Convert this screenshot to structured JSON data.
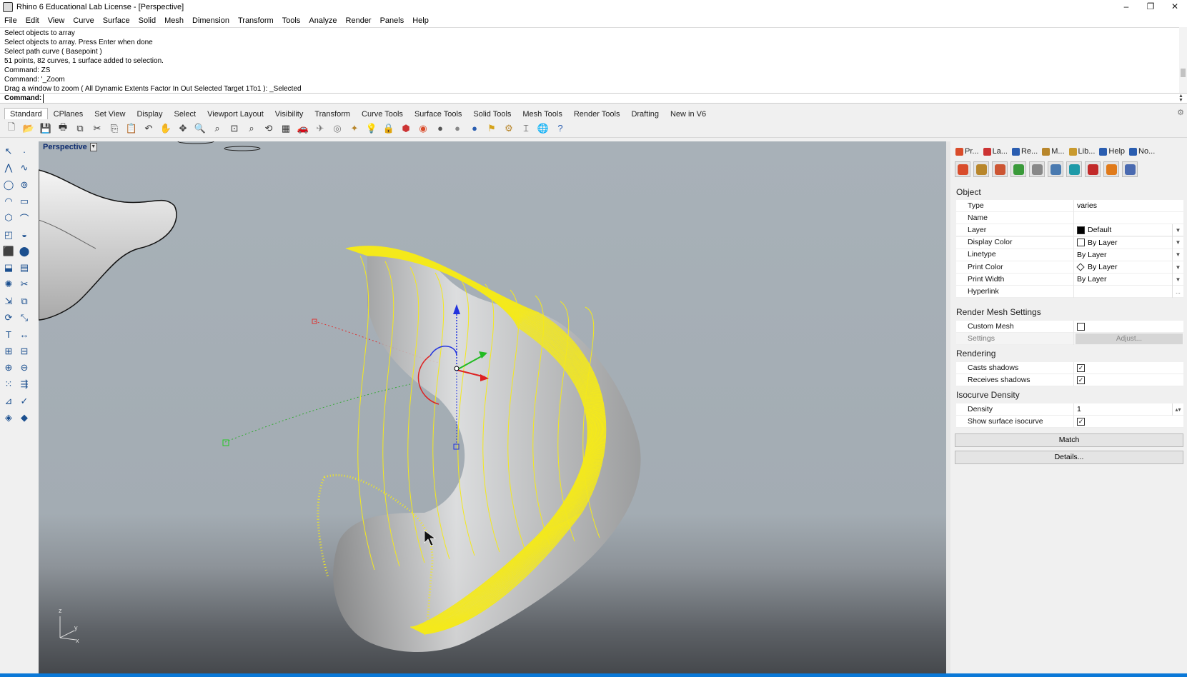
{
  "window": {
    "title": "Rhino 6 Educational Lab License - [Perspective]",
    "controls": [
      "–",
      "❐",
      "✕"
    ]
  },
  "menu": [
    "File",
    "Edit",
    "View",
    "Curve",
    "Surface",
    "Solid",
    "Mesh",
    "Dimension",
    "Transform",
    "Tools",
    "Analyze",
    "Render",
    "Panels",
    "Help"
  ],
  "history": [
    "Select objects to array",
    "Select objects to array. Press Enter when done",
    "Select path curve ( Basepoint )",
    "51 points, 82 curves, 1 surface added to selection.",
    "Command: ZS",
    "Command: '_Zoom",
    "Drag a window to zoom ( All  Dynamic  Extents  Factor  In  Out  Selected  Target  1To1 ): _Selected"
  ],
  "command": {
    "label": "Command:",
    "value": ""
  },
  "toolbar_tabs": [
    "Standard",
    "CPlanes",
    "Set View",
    "Display",
    "Select",
    "Viewport Layout",
    "Visibility",
    "Transform",
    "Curve Tools",
    "Surface Tools",
    "Solid Tools",
    "Mesh Tools",
    "Render Tools",
    "Drafting",
    "New in V6"
  ],
  "toolbar_icons": [
    {
      "name": "new-file-icon",
      "glyph": "🗋",
      "color": "#555555"
    },
    {
      "name": "open-icon",
      "glyph": "📂",
      "color": "#c99a2e"
    },
    {
      "name": "save-icon",
      "glyph": "💾",
      "color": "#333333"
    },
    {
      "name": "print-icon",
      "glyph": "🖶",
      "color": "#333333"
    },
    {
      "name": "import-icon",
      "glyph": "⧉",
      "color": "#333333"
    },
    {
      "name": "cut-icon",
      "glyph": "✂",
      "color": "#333333"
    },
    {
      "name": "copy-icon",
      "glyph": "⎘",
      "color": "#333333"
    },
    {
      "name": "paste-icon",
      "glyph": "📋",
      "color": "#c99a2e"
    },
    {
      "name": "undo-icon",
      "glyph": "↶",
      "color": "#333333"
    },
    {
      "name": "pan-icon",
      "glyph": "✋",
      "color": "#333333"
    },
    {
      "name": "rotate-view-icon",
      "glyph": "✥",
      "color": "#333333"
    },
    {
      "name": "zoom-icon",
      "glyph": "🔍",
      "color": "#333333"
    },
    {
      "name": "zoom-window-icon",
      "glyph": "⌕",
      "color": "#333333"
    },
    {
      "name": "zoom-extents-icon",
      "glyph": "⊡",
      "color": "#333333"
    },
    {
      "name": "zoom-selected-icon",
      "glyph": "⌕",
      "color": "#333333"
    },
    {
      "name": "undo-view-icon",
      "glyph": "⟲",
      "color": "#333333"
    },
    {
      "name": "four-viewports-icon",
      "glyph": "▦",
      "color": "#333333"
    },
    {
      "name": "car-icon",
      "glyph": "🚗",
      "color": "#cc2222"
    },
    {
      "name": "plane-icon",
      "glyph": "✈",
      "color": "#777777"
    },
    {
      "name": "osnap-icon",
      "glyph": "◎",
      "color": "#777777"
    },
    {
      "name": "object-properties-icon",
      "glyph": "✦",
      "color": "#b8862b"
    },
    {
      "name": "light-icon",
      "glyph": "💡",
      "color": "#888888"
    },
    {
      "name": "lock-icon",
      "glyph": "🔒",
      "color": "#333333"
    },
    {
      "name": "layers-icon",
      "glyph": "⬢",
      "color": "#cc3333"
    },
    {
      "name": "color-wheel-icon",
      "glyph": "◉",
      "color": "#d94c2b"
    },
    {
      "name": "shaded-sphere-icon",
      "glyph": "●",
      "color": "#555555"
    },
    {
      "name": "rendered-sphere-icon",
      "glyph": "●",
      "color": "#888888"
    },
    {
      "name": "render-sphere-icon",
      "glyph": "●",
      "color": "#2a5db0"
    },
    {
      "name": "flag-icon",
      "glyph": "⚑",
      "color": "#d4a21a"
    },
    {
      "name": "gear-icon",
      "glyph": "⚙",
      "color": "#b8862b"
    },
    {
      "name": "dimension-icon",
      "glyph": "⌶",
      "color": "#333333"
    },
    {
      "name": "globe-icon",
      "glyph": "🌐",
      "color": "#3a8a3a"
    },
    {
      "name": "help-icon",
      "glyph": "?",
      "color": "#2a5db0"
    }
  ],
  "left_tools": [
    {
      "name": "select-arrow-icon",
      "glyph": "↖"
    },
    {
      "name": "point-icon",
      "glyph": "·"
    },
    {
      "name": "polyline-icon",
      "glyph": "⋀"
    },
    {
      "name": "curve-icon",
      "glyph": "∿"
    },
    {
      "name": "circle-icon",
      "glyph": "◯"
    },
    {
      "name": "ellipse-icon",
      "glyph": "⊚"
    },
    {
      "name": "arc-icon",
      "glyph": "◠"
    },
    {
      "name": "rectangle-icon",
      "glyph": "▭"
    },
    {
      "name": "polygon-icon",
      "glyph": "⬡"
    },
    {
      "name": "fillet-icon",
      "glyph": "⌒"
    },
    {
      "name": "surface-corner-icon",
      "glyph": "◰"
    },
    {
      "name": "surface-loft-icon",
      "glyph": "◒"
    },
    {
      "name": "box-icon",
      "glyph": "⬛"
    },
    {
      "name": "boolean-icon",
      "glyph": "⬤"
    },
    {
      "name": "extrude-icon",
      "glyph": "⬓"
    },
    {
      "name": "mesh-icon",
      "glyph": "▤"
    },
    {
      "name": "explode-icon",
      "glyph": "✺"
    },
    {
      "name": "trim-icon",
      "glyph": "✂"
    },
    {
      "name": "move-icon",
      "glyph": "⇲"
    },
    {
      "name": "copy-tool-icon",
      "glyph": "⧉"
    },
    {
      "name": "rotate-icon",
      "glyph": "⟳"
    },
    {
      "name": "scale-icon",
      "glyph": "⤡"
    },
    {
      "name": "text-icon",
      "glyph": "T"
    },
    {
      "name": "dimension-tool-icon",
      "glyph": "↔"
    },
    {
      "name": "group-icon",
      "glyph": "⊞"
    },
    {
      "name": "array-icon",
      "glyph": "⊟"
    },
    {
      "name": "join-icon",
      "glyph": "⊕"
    },
    {
      "name": "split-icon",
      "glyph": "⊖"
    },
    {
      "name": "grid-array-icon",
      "glyph": "⁙"
    },
    {
      "name": "flow-icon",
      "glyph": "⇶"
    },
    {
      "name": "analyze-icon",
      "glyph": "⊿"
    },
    {
      "name": "check-icon",
      "glyph": "✓"
    },
    {
      "name": "render-tool-icon",
      "glyph": "◈"
    },
    {
      "name": "light-tool-icon",
      "glyph": "◆"
    }
  ],
  "viewport": {
    "label": "Perspective",
    "axes": {
      "z": "z",
      "y": "y",
      "x": "x"
    }
  },
  "panel": {
    "tabs": [
      {
        "label": "Pr...",
        "icon": "properties-icon",
        "color": "#d94c2b"
      },
      {
        "label": "La...",
        "icon": "layers-icon",
        "color": "#cc3333"
      },
      {
        "label": "Re...",
        "icon": "render-icon",
        "color": "#2a5db0"
      },
      {
        "label": "M...",
        "icon": "materials-icon",
        "color": "#b8862b"
      },
      {
        "label": "Lib...",
        "icon": "libraries-icon",
        "color": "#c99a2e"
      },
      {
        "label": "Help",
        "icon": "help-icon",
        "color": "#2a5db0"
      },
      {
        "label": "No...",
        "icon": "notifications-icon",
        "color": "#2a5db0"
      }
    ],
    "toolbar": [
      {
        "name": "object-props-icon",
        "color": "#d94c2b"
      },
      {
        "name": "material-icon",
        "color": "#b8862b"
      },
      {
        "name": "texture-icon",
        "color": "#cc5533"
      },
      {
        "name": "decal-icon",
        "color": "#3a9a3a"
      },
      {
        "name": "displacement-icon",
        "color": "#888888"
      },
      {
        "name": "edge-softening-icon",
        "color": "#4a7ab0"
      },
      {
        "name": "shut-lining-icon",
        "color": "#1e9aa8"
      },
      {
        "name": "thickness-icon",
        "color": "#c22a2a"
      },
      {
        "name": "curve-piping-icon",
        "color": "#e07a1a"
      },
      {
        "name": "cap-icon",
        "color": "#4a6ab0"
      }
    ],
    "sections": {
      "object": "Object",
      "render_mesh": "Render Mesh Settings",
      "rendering": "Rendering",
      "isocurve": "Isocurve Density"
    },
    "object_rows": [
      {
        "key": "Type",
        "value": "varies",
        "dropdown": false
      },
      {
        "key": "Name",
        "value": "",
        "dropdown": false
      },
      {
        "key": "Layer",
        "value": "Default",
        "dropdown": true,
        "swatch": "#000000"
      },
      {
        "key": "Display Color",
        "value": "By Layer",
        "dropdown": true,
        "swatch": "#ffffff"
      },
      {
        "key": "Linetype",
        "value": "By Layer",
        "dropdown": true
      },
      {
        "key": "Print Color",
        "value": "By Layer",
        "dropdown": true
      },
      {
        "key": "Print Width",
        "value": "By Layer",
        "dropdown": true
      },
      {
        "key": "Hyperlink",
        "value": "",
        "dropdown": false
      }
    ],
    "custom_mesh": {
      "key": "Custom Mesh",
      "checked": false
    },
    "settings": {
      "key": "Settings",
      "button": "Adjust..."
    },
    "casts_shadows": {
      "key": "Casts shadows",
      "checked": true
    },
    "receives_shadows": {
      "key": "Receives shadows",
      "checked": true
    },
    "density": {
      "key": "Density",
      "value": "1"
    },
    "show_isocurve": {
      "key": "Show surface isocurve",
      "checked": true
    },
    "match_button": "Match",
    "details_button": "Details...",
    "hyperlink_button": "..."
  },
  "colors": {
    "selection_yellow": "#f4e91c",
    "surface_gray": "#cfcfcf"
  }
}
